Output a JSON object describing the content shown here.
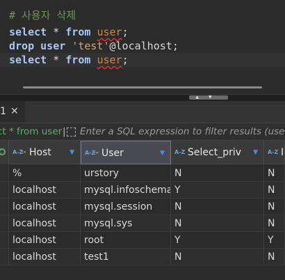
{
  "editor": {
    "comment": "# 사용자 삭제",
    "line2": {
      "kw1": "select",
      "op": "*",
      "kw2": "from",
      "ident": "user",
      "end": ";"
    },
    "line3": {
      "kw1": "drop",
      "kw2": "user",
      "str": "'test'",
      "host": "@localhost",
      "end": ";"
    },
    "line4": {
      "kw1": "select",
      "op": "*",
      "kw2": "from",
      "ident": "user",
      "end": ";"
    }
  },
  "results_tab": {
    "label": "1",
    "close_icon": "close-icon"
  },
  "filter": {
    "last_query": "ct * from user",
    "separator": "|",
    "placeholder": "Enter a SQL expression to filter results (use Ctrl+Space)"
  },
  "grid": {
    "columns": [
      {
        "name": "Host",
        "type_icon": "az-text-icon",
        "key_icon": "key-icon"
      },
      {
        "name": "User",
        "type_icon": "az-text-icon",
        "key_icon": "key-icon"
      },
      {
        "name": "Select_priv",
        "type_icon": "az-text-icon"
      },
      {
        "name": "I",
        "type_icon": "az-text-icon"
      }
    ],
    "rows": [
      [
        "%",
        "urstory",
        "N",
        "N"
      ],
      [
        "localhost",
        "mysql.infoschema",
        "Y",
        "N"
      ],
      [
        "localhost",
        "mysql.session",
        "N",
        "N"
      ],
      [
        "localhost",
        "mysql.sys",
        "N",
        "N"
      ],
      [
        "localhost",
        "root",
        "Y",
        "Y"
      ],
      [
        "localhost",
        "test1",
        "N",
        "N"
      ]
    ]
  },
  "colors": {
    "keyword": "#a9c8f5",
    "comment": "#6a9955",
    "identifier": "#cc8a46",
    "string": "#cfa877"
  }
}
